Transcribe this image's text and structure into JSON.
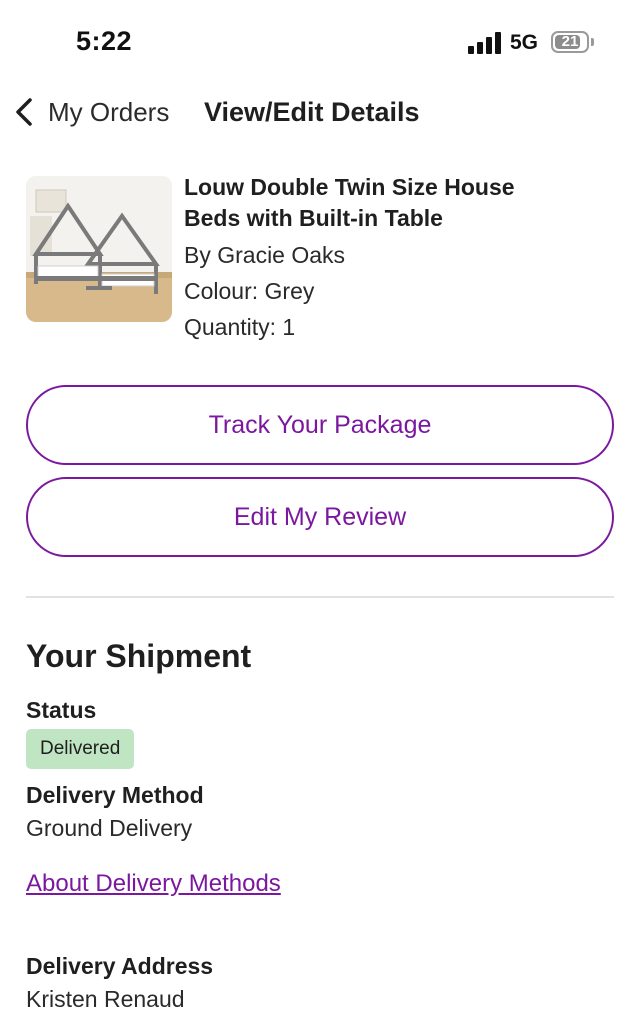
{
  "status_bar": {
    "time": "5:22",
    "network": "5G",
    "battery_level": "21",
    "battery_fraction": 0.21
  },
  "nav": {
    "back_label": "My Orders",
    "title": "View/Edit Details",
    "back_icon": "chevron-left-icon"
  },
  "product": {
    "name_line1": "Louw Double Twin Size House",
    "name_line2": "Beds with Built-in Table",
    "brand": "By Gracie Oaks",
    "colour": "Colour: Grey",
    "quantity": "Quantity: 1",
    "image": "house-bed-image"
  },
  "actions": {
    "track_label": "Track Your Package",
    "review_label": "Edit My Review"
  },
  "shipment": {
    "title": "Your Shipment",
    "status_label": "Status",
    "status_value": "Delivered",
    "method_label": "Delivery Method",
    "method_value": "Ground Delivery",
    "about_link": "About Delivery Methods",
    "address_label": "Delivery Address",
    "address_name": "Kristen Renaud"
  },
  "colors": {
    "accent": "#7b189f",
    "badge_bg": "#bfe5c2",
    "divider": "#e2e2e2"
  }
}
